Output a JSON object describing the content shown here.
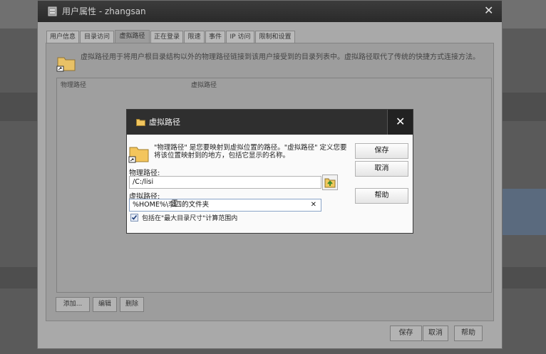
{
  "window": {
    "title": "用户属性 - zhangsan",
    "close_label": "✕",
    "tabs": [
      "用户信息",
      "目录访问",
      "虚拟路径",
      "正在登录",
      "限速",
      "事件",
      "IP 访问",
      "限制和设置"
    ],
    "active_tab": "虚拟路径",
    "description": "虚拟路径用于将用户根目录结构以外的物理路径链接到该用户接受到的目录列表中。虚拟路径取代了传统的快捷方式连接方法。",
    "columns": [
      "物理路径",
      "虚拟路径"
    ],
    "buttons": {
      "add": "添加...",
      "edit": "编辑",
      "delete": "删除"
    },
    "footer": {
      "save": "保存",
      "cancel": "取消",
      "help": "帮助"
    }
  },
  "dialog": {
    "title": "虚拟路径",
    "close_label": "✕",
    "description": "\"物理路径\" 是您要映射到虚拟位置的路径。\"虚拟路径\" 定义您要将该位置映射到的地方，包括它显示的名称。",
    "physical_label": "物理路径:",
    "physical_value": "/C:/lisi",
    "virtual_label": "虚拟路径:",
    "virtual_value": "%HOME%\\李四的文件夹",
    "clear_label": "✕",
    "checkbox_label": "包括在\"最大目录尺寸\"计算范围内",
    "checkbox_checked": true,
    "buttons": {
      "save": "保存",
      "cancel": "取消",
      "help": "帮助"
    }
  },
  "icons": [
    "folder-shortcut-icon",
    "close-icon",
    "browse-folder-icon",
    "checkmark-icon",
    "text-cursor-icon"
  ]
}
